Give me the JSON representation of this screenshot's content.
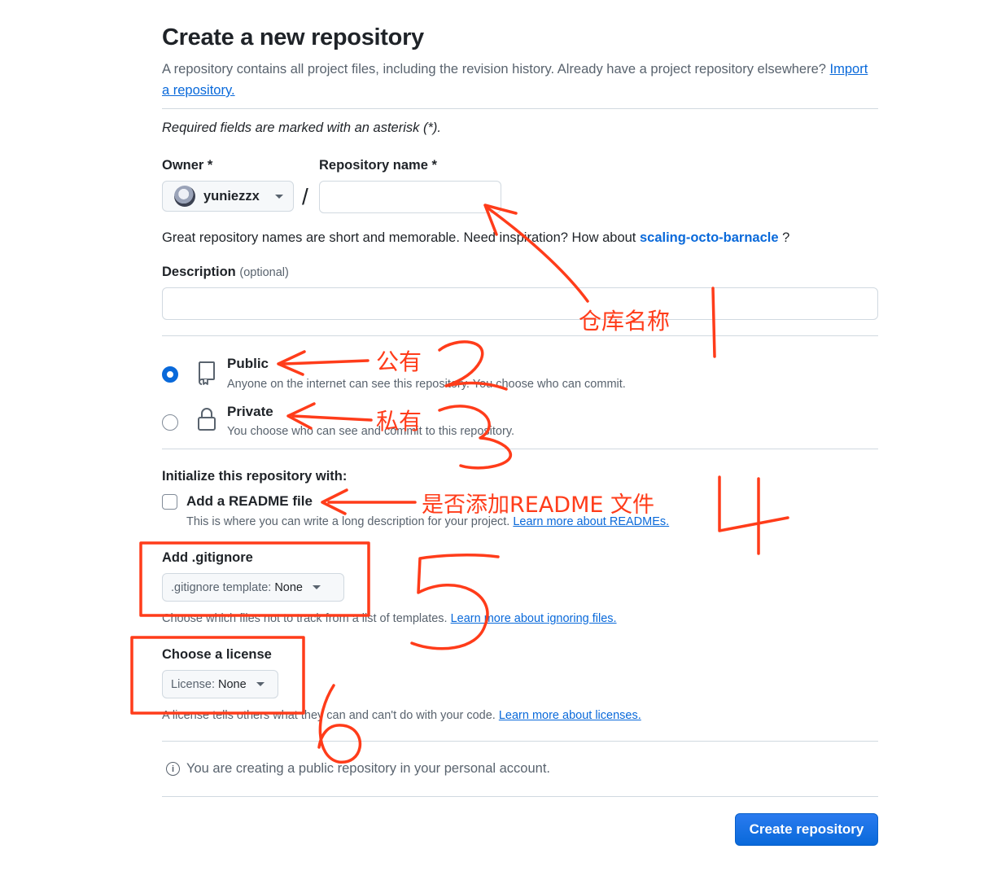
{
  "header": {
    "title": "Create a new repository",
    "lead_text": "A repository contains all project files, including the revision history. Already have a project repository elsewhere?",
    "import_link": "Import a repository."
  },
  "form": {
    "required_note": "Required fields are marked with an asterisk (*).",
    "owner_label": "Owner *",
    "owner_value": "yuniezzx",
    "slash": "/",
    "repo_name_label": "Repository name *",
    "repo_name_value": "",
    "name_hint": "Great repository names are short and memorable. Need inspiration? How about",
    "name_suggestion": "scaling-octo-barnacle",
    "name_hint_end": "?",
    "description_label": "Description",
    "description_optional": "(optional)",
    "description_value": ""
  },
  "visibility": {
    "selected": "public",
    "options": [
      {
        "title": "Public",
        "desc": "Anyone on the internet can see this repository. You choose who can commit."
      },
      {
        "title": "Private",
        "desc": "You choose who can see and commit to this repository."
      }
    ]
  },
  "init": {
    "heading": "Initialize this repository with:",
    "readme_label": "Add a README file",
    "readme_checked": false,
    "readme_desc": "This is where you can write a long description for your project.",
    "readme_link": "Learn more about READMEs.",
    "gitignore_label": "Add .gitignore",
    "gitignore_key": ".gitignore template:",
    "gitignore_value": "None",
    "gitignore_desc": "Choose which files not to track from a list of templates.",
    "gitignore_link": "Learn more about ignoring files.",
    "license_label": "Choose a license",
    "license_key": "License:",
    "license_value": "None",
    "license_desc": "A license tells others what they can and can't do with your code.",
    "license_link": "Learn more about licenses."
  },
  "footer": {
    "notice": "You are creating a public repository in your personal account.",
    "create_button": "Create repository"
  },
  "annotations": {
    "color": "#ff3c1a",
    "repo_name": "仓库名称",
    "public": "公有",
    "private": "私有",
    "readme": "是否添加README 文件"
  },
  "colors": {
    "accent": "#0969da",
    "primary_button": "#1f6feb",
    "muted_text": "#59636e",
    "border": "#d1d9e0"
  }
}
